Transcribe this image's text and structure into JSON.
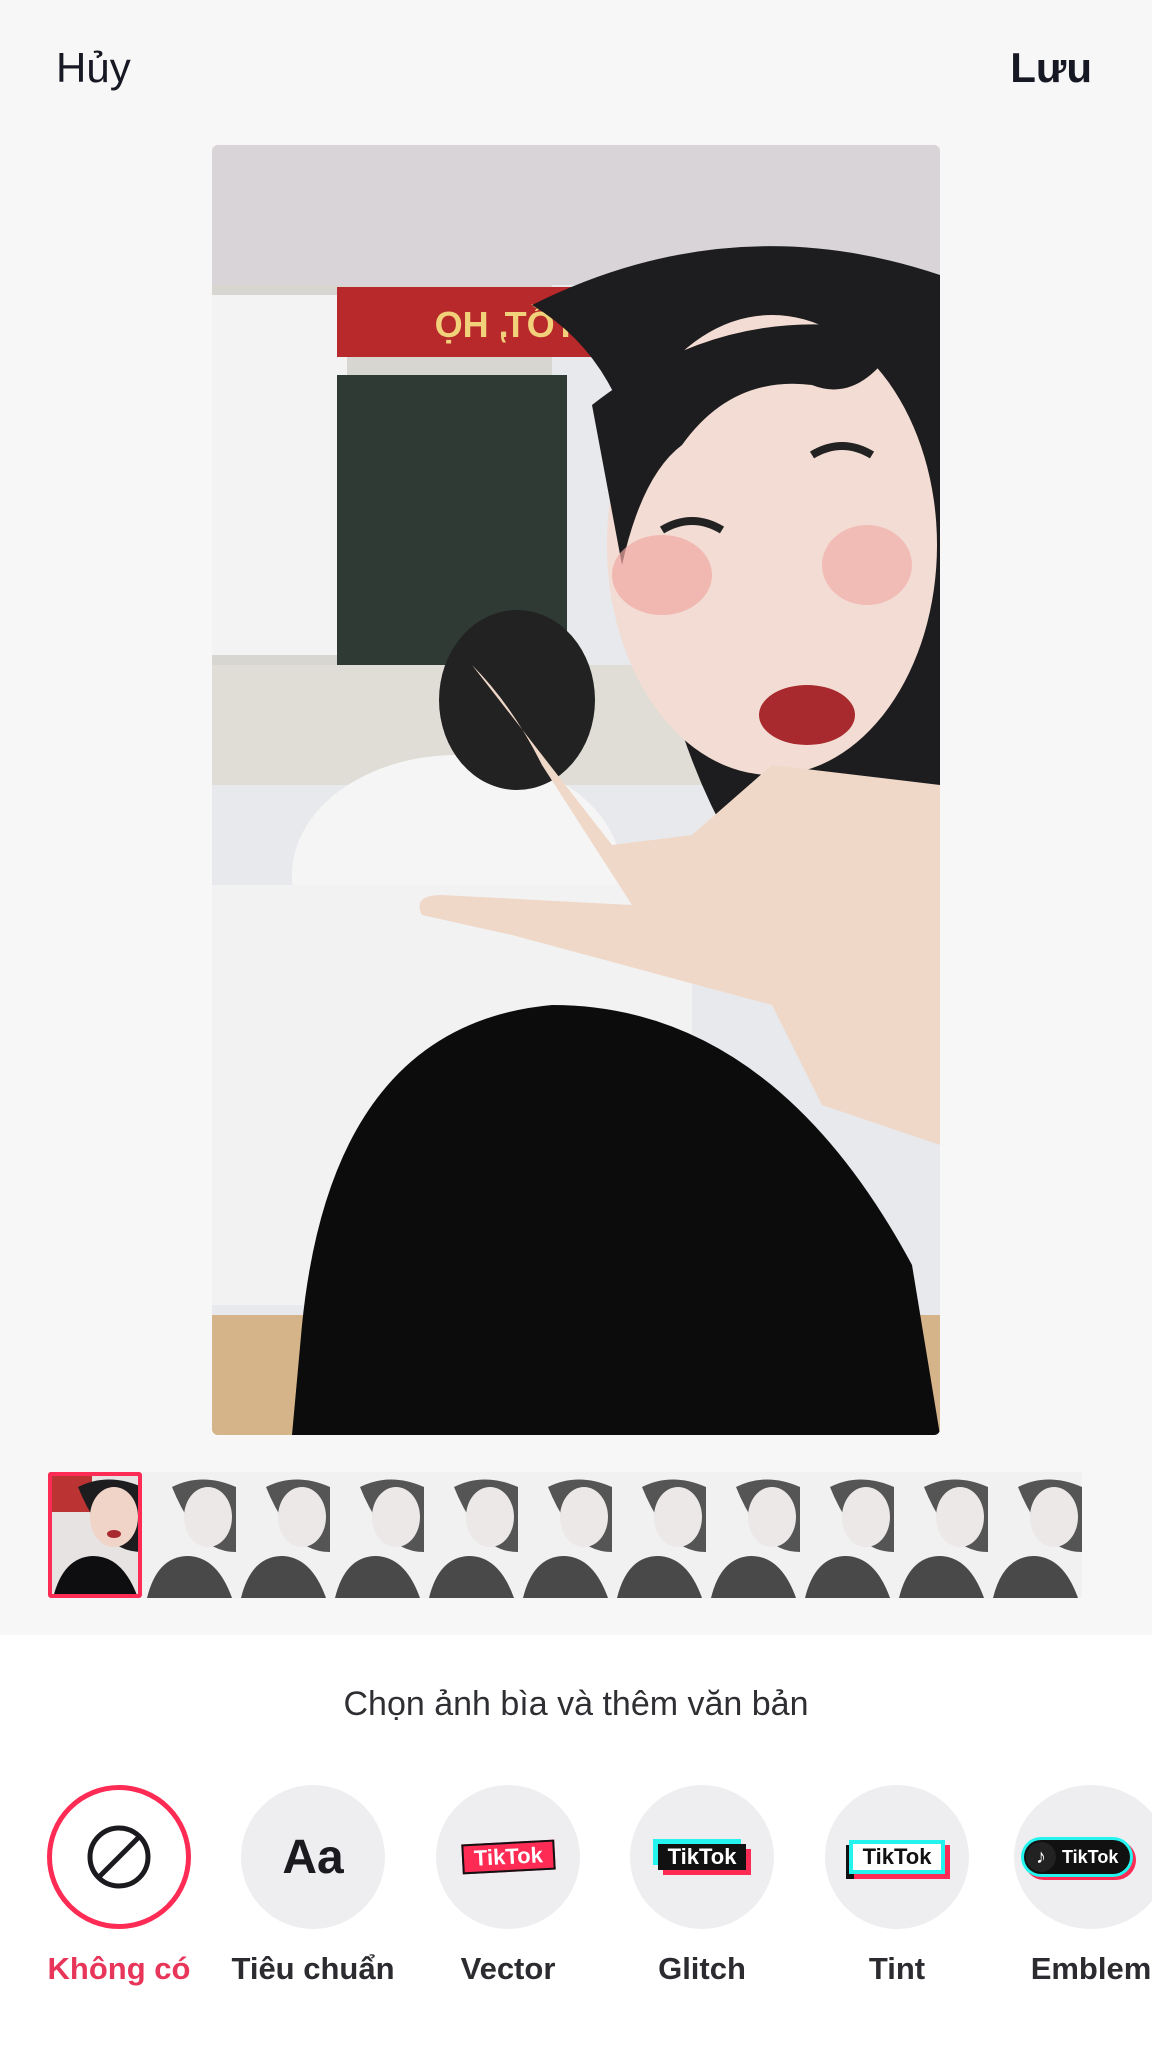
{
  "header": {
    "cancel_label": "Hủy",
    "save_label": "Lưu"
  },
  "preview": {
    "banner_text": "ĐẠY TỐT, HỌ"
  },
  "thumbnails": {
    "count": 11,
    "selected_index": 0
  },
  "sheet": {
    "title": "Chọn ảnh bìa và thêm văn bản",
    "styles": [
      {
        "label": "Không có",
        "icon": "none-icon",
        "selected": true
      },
      {
        "label": "Tiêu chuẩn",
        "icon": "text-aa-icon",
        "selected": false
      },
      {
        "label": "Vector",
        "icon": "tiktok-vector-badge",
        "badge_text": "TikTok",
        "selected": false
      },
      {
        "label": "Glitch",
        "icon": "tiktok-glitch-badge",
        "badge_text": "TikTok",
        "selected": false
      },
      {
        "label": "Tint",
        "icon": "tiktok-tint-badge",
        "badge_text": "TikTok",
        "selected": false
      },
      {
        "label": "Emblem",
        "icon": "tiktok-emblem-badge",
        "badge_text": "TikTok",
        "selected": false
      }
    ],
    "standard_glyph": "Aa"
  },
  "colors": {
    "accent": "#fe2c55",
    "text": "#161823",
    "background": "#f7f7f7"
  }
}
